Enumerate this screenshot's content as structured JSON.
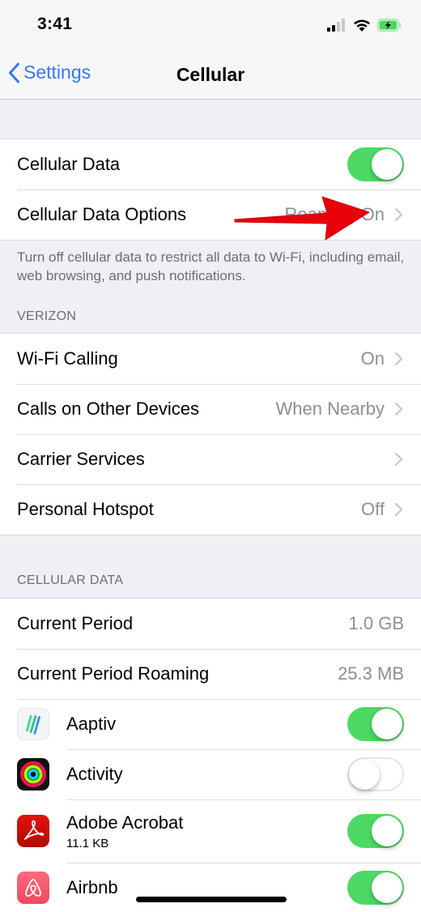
{
  "status_bar": {
    "time": "3:41",
    "signal_bars_filled": 2,
    "signal_bars_total": 4,
    "wifi": "wifi-icon",
    "battery": "battery-charging-icon",
    "battery_color": "#4cd964"
  },
  "nav": {
    "back_label": "Settings",
    "title": "Cellular",
    "accent_color": "#3478f6"
  },
  "group1": {
    "rows": [
      {
        "label": "Cellular Data",
        "toggle": "on"
      },
      {
        "label": "Cellular Data Options",
        "value": "Roaming On",
        "chevron": true
      }
    ],
    "footer": "Turn off cellular data to restrict all data to Wi-Fi, including email, web browsing, and push notifications."
  },
  "annotation": {
    "type": "red-arrow",
    "color": "#e8000b",
    "points_to": "Cellular Data Options value"
  },
  "carrier_section": {
    "header": "VERIZON",
    "rows": [
      {
        "label": "Wi-Fi Calling",
        "value": "On",
        "chevron": true
      },
      {
        "label": "Calls on Other Devices",
        "value": "When Nearby",
        "chevron": true
      },
      {
        "label": "Carrier Services",
        "value": "",
        "chevron": true
      },
      {
        "label": "Personal Hotspot",
        "value": "Off",
        "chevron": true
      }
    ]
  },
  "cellular_data_section": {
    "header": "CELLULAR DATA",
    "rows": [
      {
        "label": "Current Period",
        "value": "1.0 GB"
      },
      {
        "label": "Current Period Roaming",
        "value": "25.3 MB"
      }
    ],
    "apps": [
      {
        "name": "Aaptiv",
        "icon": "aaptiv-icon",
        "usage": "",
        "toggle": "on"
      },
      {
        "name": "Activity",
        "icon": "activity-rings-icon",
        "usage": "",
        "toggle": "off"
      },
      {
        "name": "Adobe Acrobat",
        "icon": "adobe-acrobat-icon",
        "usage": "11.1 KB",
        "toggle": "on"
      },
      {
        "name": "Airbnb",
        "icon": "airbnb-icon",
        "usage": "",
        "toggle": "on"
      }
    ]
  },
  "colors": {
    "toggle_on": "#4cd964",
    "background": "#efeff4",
    "secondary_text": "#8e8e93"
  }
}
